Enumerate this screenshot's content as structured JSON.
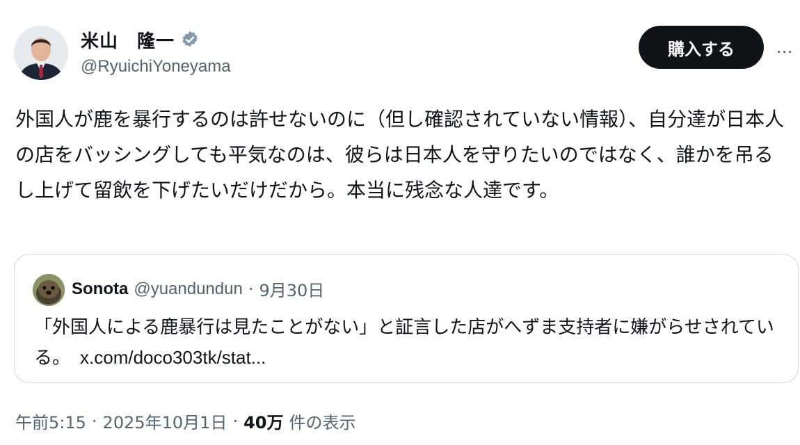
{
  "author": {
    "name": "米山　隆一",
    "handle": "@RyuichiYoneyama",
    "verified": true
  },
  "actions": {
    "buy_label": "購入する",
    "more_label": "…"
  },
  "tweet": {
    "text": "外国人が鹿を暴行するのは許せないのに（但し確認されていない情報）、自分達が日本人の店をバッシングしても平気なのは、彼らは日本人を守りたいのではなく、誰かを吊るし上げて留飲を下げたいだけだから。本当に残念な人達です。"
  },
  "quote": {
    "name": "Sonota",
    "handle": "@yuandundun",
    "separator": "·",
    "date": "9月30日",
    "text": "「外国人による鹿暴行は見たことがない」と証言した店がへずま支持者に嫌がらせされている。",
    "link": "x.com/doco303tk/stat..."
  },
  "meta": {
    "time": "午前5:15",
    "sep1": "·",
    "date": "2025年10月1日",
    "sep2": "·",
    "views_count": "40万",
    "views_label": "件の表示"
  },
  "colors": {
    "text": "#0f1419",
    "secondary": "#536471",
    "verified": "#829aab",
    "button_bg": "#0f1419",
    "border": "#cfd9de"
  }
}
